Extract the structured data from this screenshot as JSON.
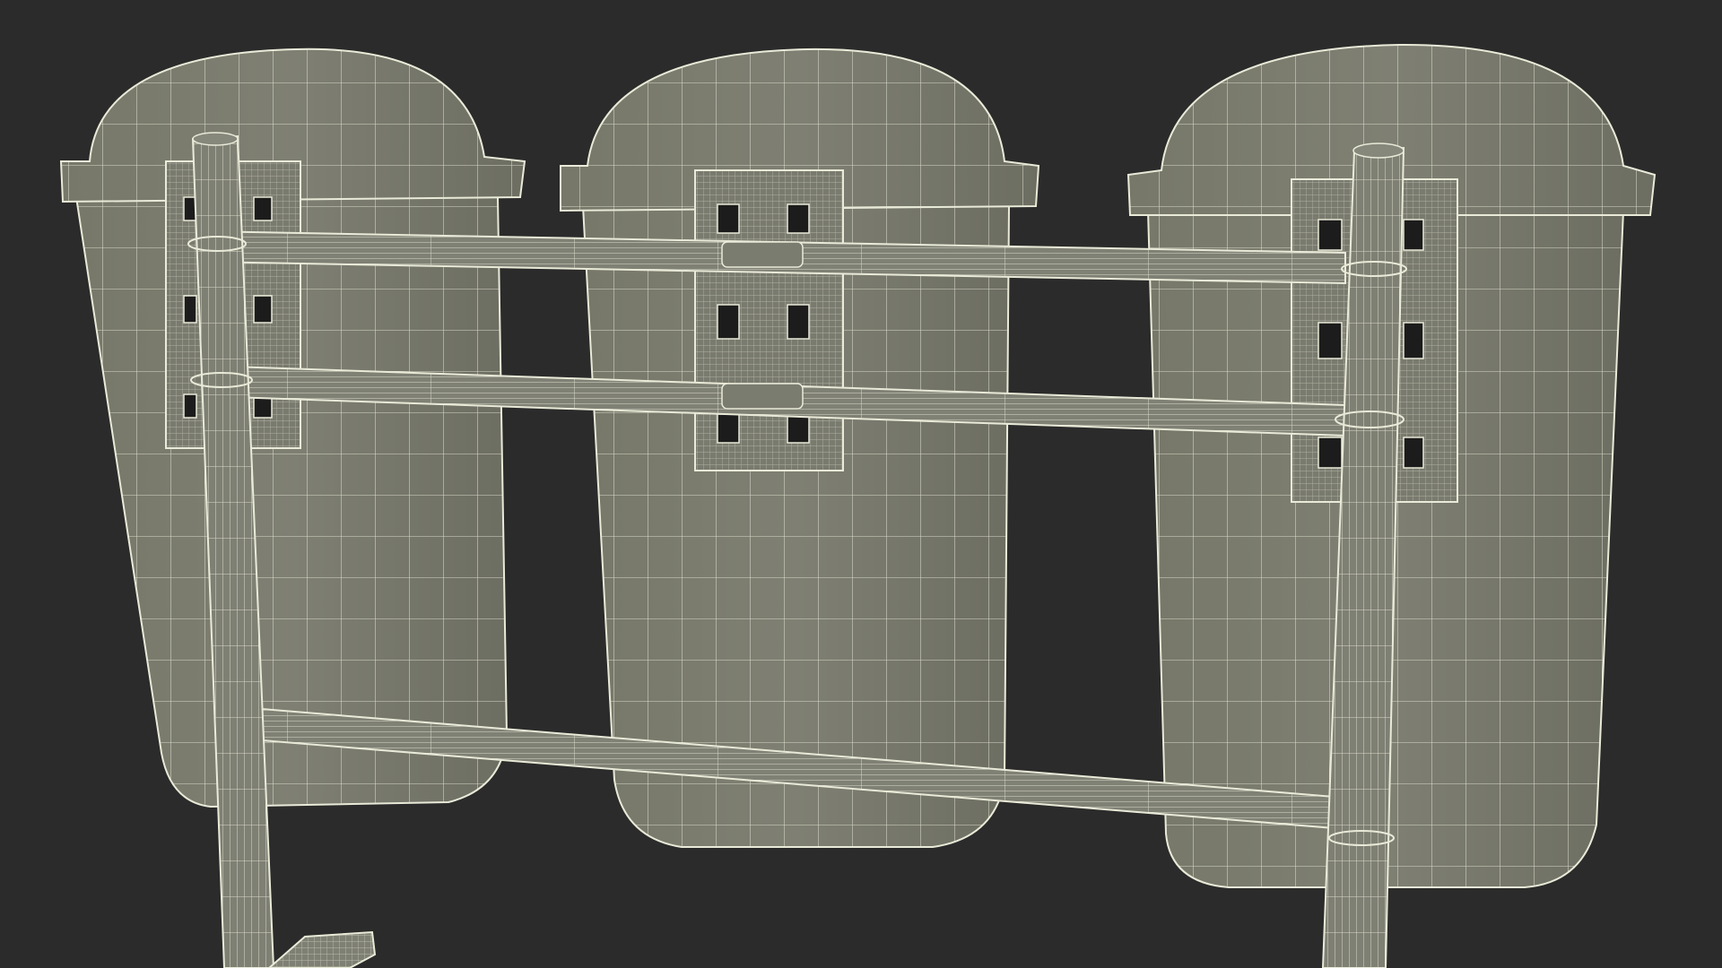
{
  "scene": {
    "background": "#2b2b2b",
    "surface_color": "#7d7e72",
    "surface_shade": "#6e6f64",
    "wire_color": "#e9ead8",
    "hole_color": "#1c1c1c",
    "bin_count": 3
  }
}
